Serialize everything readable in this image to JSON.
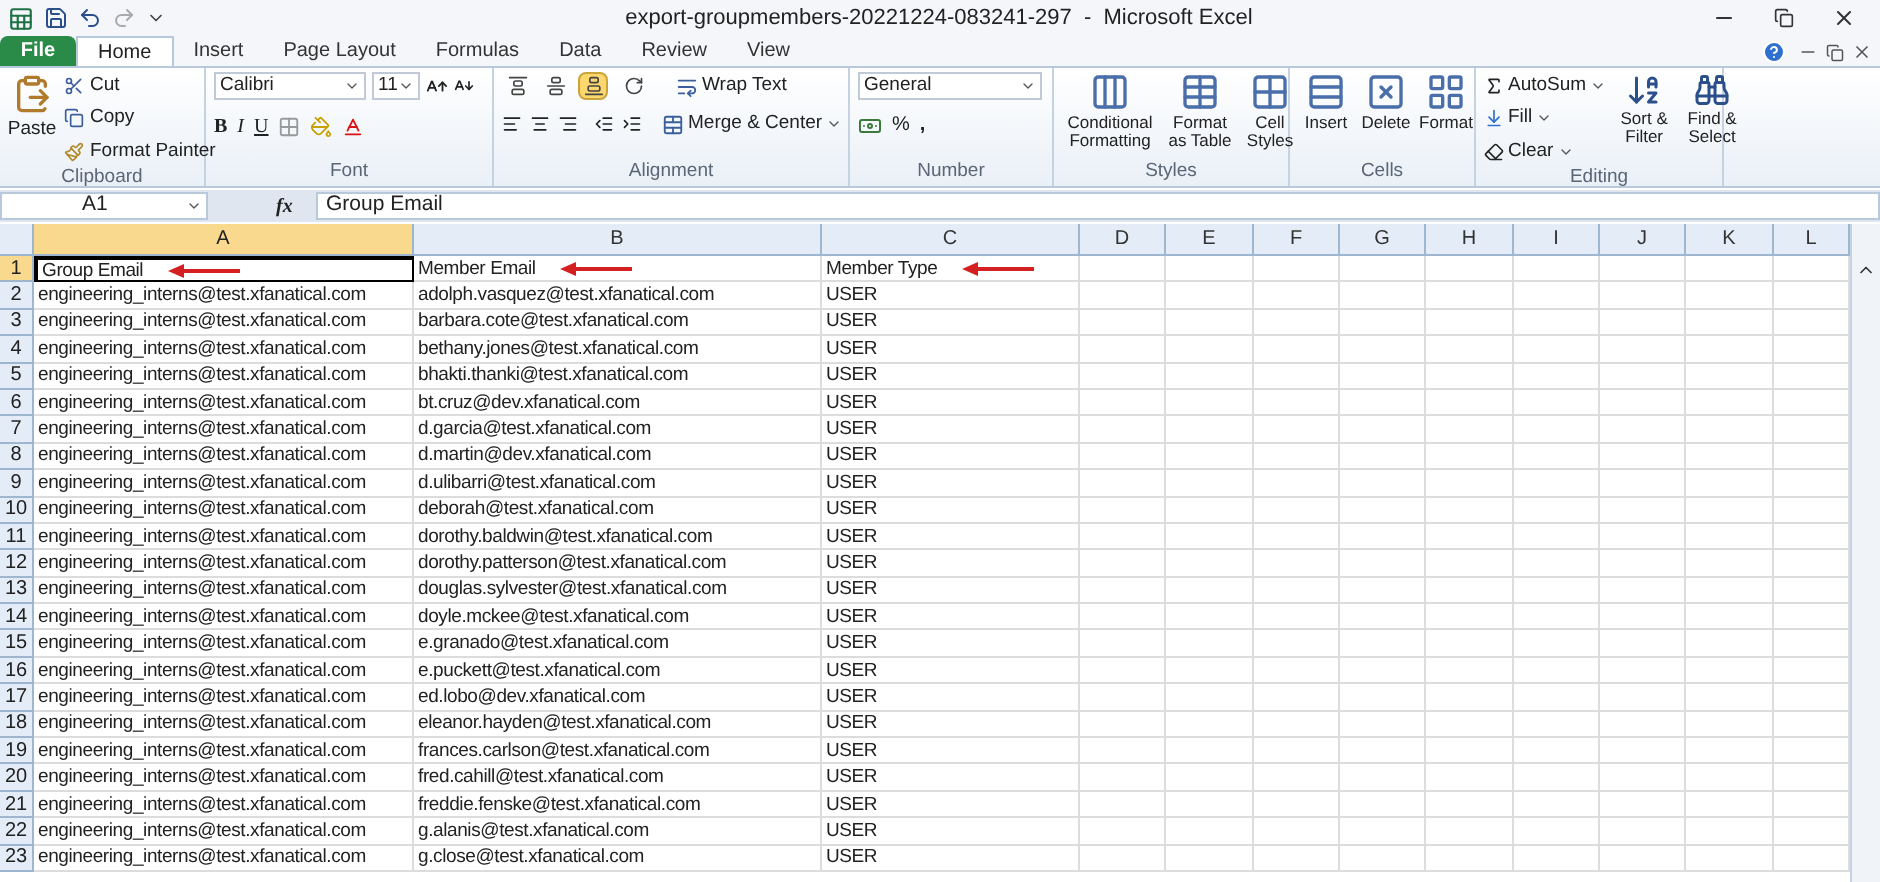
{
  "window": {
    "title": "export-groupmembers-20221224-083241-297  -  Microsoft Excel"
  },
  "tabs": [
    {
      "label": "File",
      "selected": false,
      "kind": "file"
    },
    {
      "label": "Home",
      "selected": true,
      "kind": "tab"
    },
    {
      "label": "Insert",
      "selected": false,
      "kind": "tab"
    },
    {
      "label": "Page Layout",
      "selected": false,
      "kind": "tab"
    },
    {
      "label": "Formulas",
      "selected": false,
      "kind": "tab"
    },
    {
      "label": "Data",
      "selected": false,
      "kind": "tab"
    },
    {
      "label": "Review",
      "selected": false,
      "kind": "tab"
    },
    {
      "label": "View",
      "selected": false,
      "kind": "tab"
    }
  ],
  "ribbon": {
    "clipboard": {
      "name": "Clipboard",
      "paste": "Paste",
      "cut": "Cut",
      "copy": "Copy",
      "format_painter": "Format Painter"
    },
    "font": {
      "name": "Font",
      "family": "Calibri",
      "size": "11",
      "bold": "B",
      "italic": "I",
      "underline": "U"
    },
    "alignment": {
      "name": "Alignment",
      "wrap_text": "Wrap Text",
      "merge": "Merge & Center",
      "vertical_align": [
        {
          "selected": false
        },
        {
          "selected": false
        },
        {
          "selected": true
        }
      ]
    },
    "number": {
      "name": "Number",
      "format": "General",
      "percent": "%",
      "comma": ","
    },
    "styles": {
      "name": "Styles",
      "buttons": [
        "Conditional Formatting",
        "Format as Table",
        "Cell Styles"
      ]
    },
    "cells": {
      "name": "Cells",
      "buttons": [
        "Insert",
        "Delete",
        "Format"
      ]
    },
    "editing": {
      "name": "Editing",
      "autosum": "AutoSum",
      "fill": "Fill",
      "clear": "Clear",
      "buttons": [
        "Sort & Filter",
        "Find & Select"
      ]
    }
  },
  "formula_bar": {
    "name_box": "A1",
    "function_label": "fx",
    "value": "Group Email"
  },
  "sheet": {
    "columns": [
      {
        "label": "A",
        "selected": true
      },
      {
        "label": "B",
        "selected": false
      },
      {
        "label": "C",
        "selected": false
      },
      {
        "label": "D",
        "selected": false
      },
      {
        "label": "E",
        "selected": false
      },
      {
        "label": "F",
        "selected": false
      },
      {
        "label": "G",
        "selected": false
      },
      {
        "label": "H",
        "selected": false
      },
      {
        "label": "I",
        "selected": false
      },
      {
        "label": "J",
        "selected": false
      },
      {
        "label": "K",
        "selected": false
      },
      {
        "label": "L",
        "selected": false
      }
    ],
    "rows": [
      {
        "number": "1",
        "selected": true,
        "arrows": true,
        "cells": [
          "Group Email",
          "Member Email",
          "Member Type"
        ]
      },
      {
        "number": "2",
        "selected": false,
        "arrows": false,
        "cells": [
          "engineering_interns@test.xfanatical.com",
          "adolph.vasquez@test.xfanatical.com",
          "USER"
        ]
      },
      {
        "number": "3",
        "selected": false,
        "arrows": false,
        "cells": [
          "engineering_interns@test.xfanatical.com",
          "barbara.cote@test.xfanatical.com",
          "USER"
        ]
      },
      {
        "number": "4",
        "selected": false,
        "arrows": false,
        "cells": [
          "engineering_interns@test.xfanatical.com",
          "bethany.jones@test.xfanatical.com",
          "USER"
        ]
      },
      {
        "number": "5",
        "selected": false,
        "arrows": false,
        "cells": [
          "engineering_interns@test.xfanatical.com",
          "bhakti.thanki@test.xfanatical.com",
          "USER"
        ]
      },
      {
        "number": "6",
        "selected": false,
        "arrows": false,
        "cells": [
          "engineering_interns@test.xfanatical.com",
          "bt.cruz@dev.xfanatical.com",
          "USER"
        ]
      },
      {
        "number": "7",
        "selected": false,
        "arrows": false,
        "cells": [
          "engineering_interns@test.xfanatical.com",
          "d.garcia@test.xfanatical.com",
          "USER"
        ]
      },
      {
        "number": "8",
        "selected": false,
        "arrows": false,
        "cells": [
          "engineering_interns@test.xfanatical.com",
          "d.martin@dev.xfanatical.com",
          "USER"
        ]
      },
      {
        "number": "9",
        "selected": false,
        "arrows": false,
        "cells": [
          "engineering_interns@test.xfanatical.com",
          "d.ulibarri@test.xfanatical.com",
          "USER"
        ]
      },
      {
        "number": "10",
        "selected": false,
        "arrows": false,
        "cells": [
          "engineering_interns@test.xfanatical.com",
          "deborah@test.xfanatical.com",
          "USER"
        ]
      },
      {
        "number": "11",
        "selected": false,
        "arrows": false,
        "cells": [
          "engineering_interns@test.xfanatical.com",
          "dorothy.baldwin@test.xfanatical.com",
          "USER"
        ]
      },
      {
        "number": "12",
        "selected": false,
        "arrows": false,
        "cells": [
          "engineering_interns@test.xfanatical.com",
          "dorothy.patterson@test.xfanatical.com",
          "USER"
        ]
      },
      {
        "number": "13",
        "selected": false,
        "arrows": false,
        "cells": [
          "engineering_interns@test.xfanatical.com",
          "douglas.sylvester@test.xfanatical.com",
          "USER"
        ]
      },
      {
        "number": "14",
        "selected": false,
        "arrows": false,
        "cells": [
          "engineering_interns@test.xfanatical.com",
          "doyle.mckee@test.xfanatical.com",
          "USER"
        ]
      },
      {
        "number": "15",
        "selected": false,
        "arrows": false,
        "cells": [
          "engineering_interns@test.xfanatical.com",
          "e.granado@test.xfanatical.com",
          "USER"
        ]
      },
      {
        "number": "16",
        "selected": false,
        "arrows": false,
        "cells": [
          "engineering_interns@test.xfanatical.com",
          "e.puckett@test.xfanatical.com",
          "USER"
        ]
      },
      {
        "number": "17",
        "selected": false,
        "arrows": false,
        "cells": [
          "engineering_interns@test.xfanatical.com",
          "ed.lobo@dev.xfanatical.com",
          "USER"
        ]
      },
      {
        "number": "18",
        "selected": false,
        "arrows": false,
        "cells": [
          "engineering_interns@test.xfanatical.com",
          "eleanor.hayden@test.xfanatical.com",
          "USER"
        ]
      },
      {
        "number": "19",
        "selected": false,
        "arrows": false,
        "cells": [
          "engineering_interns@test.xfanatical.com",
          "frances.carlson@test.xfanatical.com",
          "USER"
        ]
      },
      {
        "number": "20",
        "selected": false,
        "arrows": false,
        "cells": [
          "engineering_interns@test.xfanatical.com",
          "fred.cahill@test.xfanatical.com",
          "USER"
        ]
      },
      {
        "number": "21",
        "selected": false,
        "arrows": false,
        "cells": [
          "engineering_interns@test.xfanatical.com",
          "freddie.fenske@test.xfanatical.com",
          "USER"
        ]
      },
      {
        "number": "22",
        "selected": false,
        "arrows": false,
        "cells": [
          "engineering_interns@test.xfanatical.com",
          "g.alanis@test.xfanatical.com",
          "USER"
        ]
      },
      {
        "number": "23",
        "selected": false,
        "arrows": false,
        "cells": [
          "engineering_interns@test.xfanatical.com",
          "g.close@test.xfanatical.com",
          "USER"
        ]
      }
    ]
  }
}
